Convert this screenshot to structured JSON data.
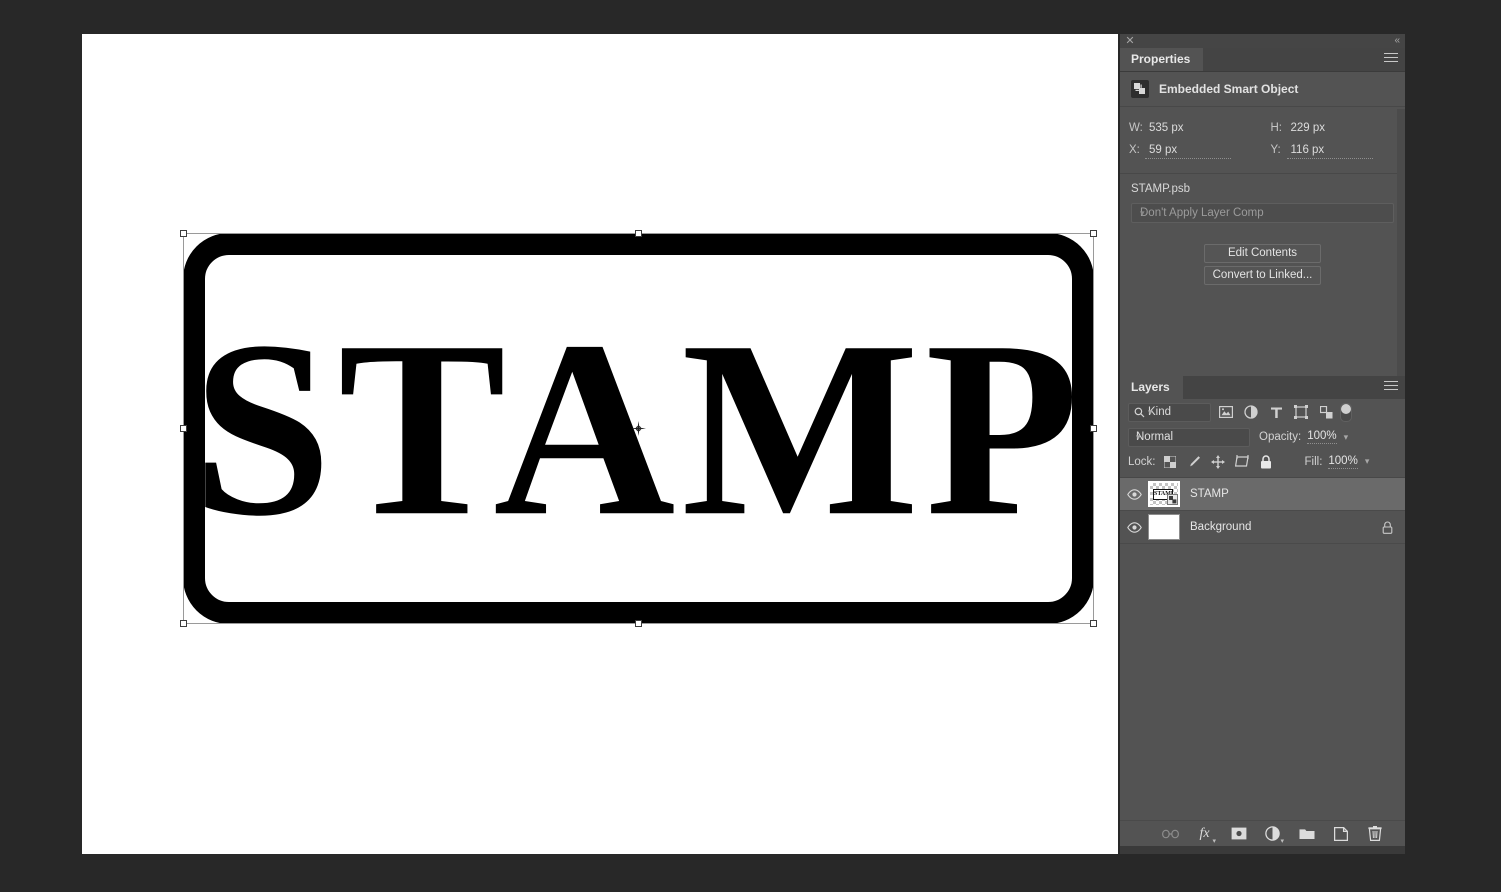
{
  "app": {
    "background_color": "#282828",
    "canvas_color": "#ffffff",
    "panel_color": "#535353"
  },
  "canvas": {
    "artwork": {
      "name": "STAMP",
      "text": "STAMP",
      "shape": "rounded-rectangle-border",
      "fill_color": "#ffffff",
      "stroke_color": "#000000"
    },
    "transform": {
      "handles": [
        "top-left",
        "top-center",
        "top-right",
        "middle-left",
        "middle-right",
        "bottom-left",
        "bottom-center",
        "bottom-right"
      ],
      "reference_point": "center"
    }
  },
  "dock": {
    "close_label": "✕",
    "collapse_label": "«"
  },
  "properties": {
    "tab_label": "Properties",
    "object_type": "Embedded Smart Object",
    "object_icon": "smart-object-icon",
    "metrics": [
      {
        "label": "W:",
        "value": "535 px",
        "scrubby": false
      },
      {
        "label": "H:",
        "value": "229 px",
        "scrubby": false
      },
      {
        "label": "X:",
        "value": "59 px",
        "scrubby": true
      },
      {
        "label": "Y:",
        "value": "116 px",
        "scrubby": true
      }
    ],
    "file_name": "STAMP.psb",
    "layer_comp": {
      "value": "Don't Apply Layer Comp",
      "options": [
        "Don't Apply Layer Comp"
      ]
    },
    "buttons": [
      {
        "label": "Edit Contents",
        "name": "edit-contents-button"
      },
      {
        "label": "Convert to Linked...",
        "name": "convert-to-linked-button"
      }
    ],
    "menu_icon": "panel-menu-icon"
  },
  "layers": {
    "tab_label": "Layers",
    "menu_icon": "panel-menu-icon",
    "filter": {
      "kind_label": "Kind",
      "search_icon": "search-icon",
      "icons": [
        {
          "name": "filter-pixel-layers-icon",
          "title": "Pixel"
        },
        {
          "name": "filter-adjustment-layers-icon",
          "title": "Adjustment"
        },
        {
          "name": "filter-type-layers-icon",
          "title": "Type"
        },
        {
          "name": "filter-shape-layers-icon",
          "title": "Shape"
        },
        {
          "name": "filter-smart-object-layers-icon",
          "title": "Smart Object"
        }
      ],
      "toggle_name": "filter-enable-toggle"
    },
    "blend": {
      "mode": "Normal",
      "modes": [
        "Normal"
      ],
      "opacity_label": "Opacity:",
      "opacity_value": "100%"
    },
    "lock": {
      "label": "Lock:",
      "icons": [
        {
          "name": "lock-transparent-pixels-icon"
        },
        {
          "name": "lock-image-pixels-icon"
        },
        {
          "name": "lock-position-icon"
        },
        {
          "name": "lock-artboard-nesting-icon"
        },
        {
          "name": "lock-all-icon"
        }
      ],
      "fill_label": "Fill:",
      "fill_value": "100%"
    },
    "rows": [
      {
        "name": "STAMP",
        "visible": true,
        "selected": true,
        "thumb_type": "smart-object",
        "thumb_text": "STAMP",
        "locked": false
      },
      {
        "name": "Background",
        "visible": true,
        "selected": false,
        "thumb_type": "solid-white",
        "thumb_text": "",
        "locked": true
      }
    ],
    "bottom_tools": [
      {
        "name": "link-layers-icon",
        "label": "∞"
      },
      {
        "name": "layer-style-fx-icon",
        "label": "fx"
      },
      {
        "name": "add-layer-mask-icon",
        "label": ""
      },
      {
        "name": "new-adjustment-layer-icon",
        "label": ""
      },
      {
        "name": "new-group-icon",
        "label": ""
      },
      {
        "name": "new-layer-icon",
        "label": ""
      },
      {
        "name": "delete-layer-icon",
        "label": ""
      }
    ]
  }
}
